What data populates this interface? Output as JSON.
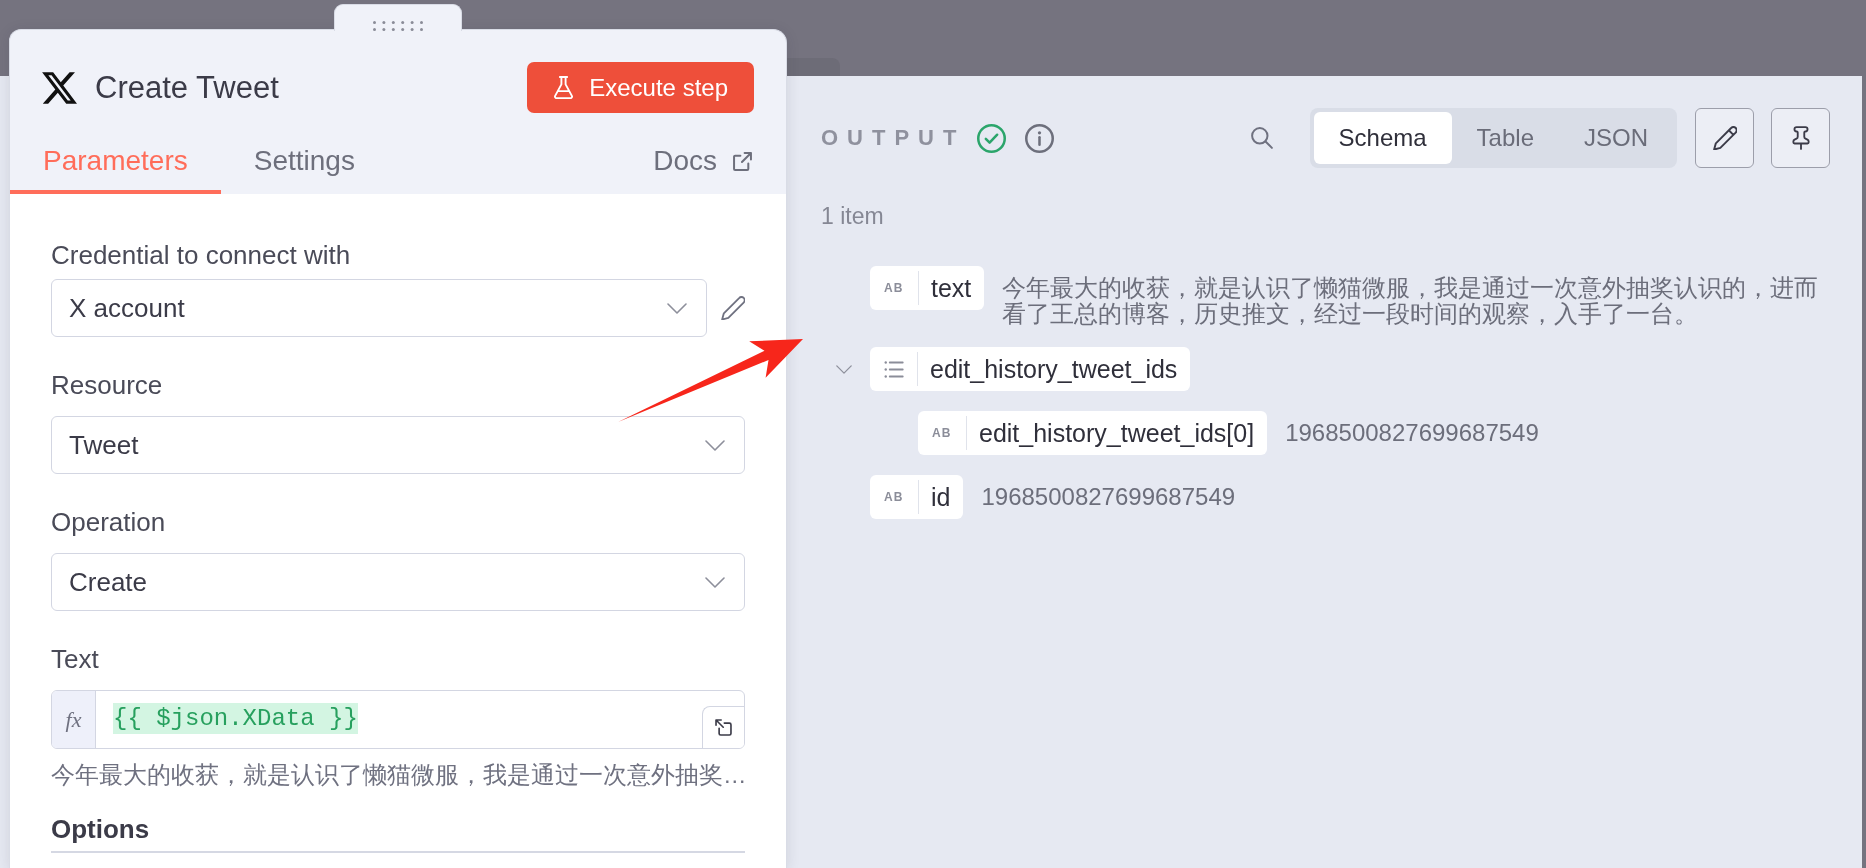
{
  "node_panel": {
    "title": "Create Tweet",
    "execute_button": "Execute step",
    "tabs": [
      {
        "label": "Parameters",
        "selected": true
      },
      {
        "label": "Settings",
        "selected": false
      }
    ],
    "docs_link": "Docs",
    "fields": [
      {
        "kind": "credential",
        "label": "Credential to connect with",
        "value": "X account"
      },
      {
        "kind": "select",
        "label": "Resource",
        "value": "Tweet"
      },
      {
        "kind": "select",
        "label": "Operation",
        "value": "Create"
      },
      {
        "kind": "expression",
        "label": "Text",
        "prefix": "fx",
        "value": "{{ $json.XData }}",
        "hint": "今年最大的收获，就是认识了懒猫微服，我是通过一次意外抽奖…"
      }
    ],
    "options_heading": "Options"
  },
  "output_panel": {
    "title": "OUTPUT",
    "success": true,
    "views": [
      {
        "label": "Schema",
        "selected": true
      },
      {
        "label": "Table",
        "selected": false
      },
      {
        "label": "JSON",
        "selected": false
      }
    ],
    "item_count": "1 item",
    "schema": [
      {
        "kind": "string",
        "badge": "AB",
        "key": "text",
        "value": "今年最大的收获，就是认识了懒猫微服，我是通过一次意外抽奖认识的，进而看了王总的博客，历史推文，经过一段时间的观察，入手了一台。"
      },
      {
        "kind": "array",
        "key": "edit_history_tweet_ids",
        "expanded": true,
        "children": [
          {
            "kind": "string",
            "badge": "AB",
            "key": "edit_history_tweet_ids[0]",
            "value": "1968500827699687549"
          }
        ]
      },
      {
        "kind": "string",
        "badge": "AB",
        "key": "id",
        "value": "1968500827699687549"
      }
    ]
  }
}
